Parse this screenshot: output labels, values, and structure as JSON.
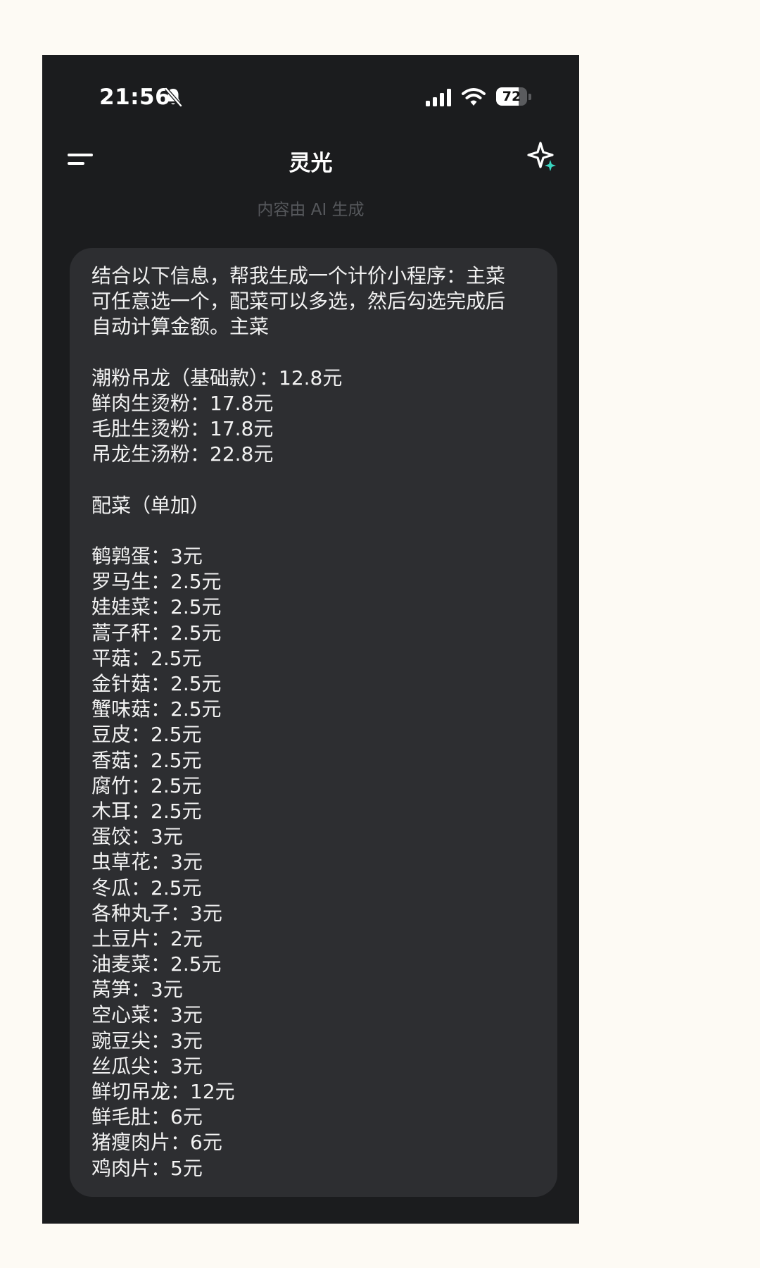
{
  "status_bar": {
    "time": "21:56",
    "battery_level": 72,
    "battery_text": "72"
  },
  "header": {
    "title": "灵光",
    "ai_note": "内容由 AI 生成"
  },
  "message": {
    "lines": [
      "结合以下信息，帮我生成一个计价小程序：主菜",
      "可任意选一个，配菜可以多选，然后勾选完成后",
      "自动计算金额。主菜",
      "",
      "潮粉吊龙（基础款）：12.8元",
      "鲜肉生烫粉：17.8元",
      "毛肚生烫粉：17.8元",
      "吊龙生汤粉：22.8元",
      "",
      "配菜（单加）",
      "",
      "鹌鹑蛋：3元",
      "罗马生：2.5元",
      "娃娃菜：2.5元",
      "蒿子秆：2.5元",
      "平菇：2.5元",
      "金针菇：2.5元",
      "蟹味菇：2.5元",
      "豆皮：2.5元",
      "香菇：2.5元",
      "腐竹：2.5元",
      "木耳：2.5元",
      "蛋饺：3元",
      "虫草花：3元",
      "冬瓜：2.5元",
      "各种丸子：3元",
      "土豆片：2元",
      "油麦菜：2.5元",
      "莴笋：3元",
      "空心菜：3元",
      "豌豆尖：3元",
      "丝瓜尖：3元",
      "鲜切吊龙：12元",
      "鲜毛肚：6元",
      "猪瘦肉片：6元",
      "鸡肉片：5元"
    ]
  },
  "colors": {
    "app_background": "#1b1c1e",
    "bubble_background": "#2d2e31",
    "text": "#f2f2f2",
    "sparkle_accent": "#3ad6c1"
  }
}
